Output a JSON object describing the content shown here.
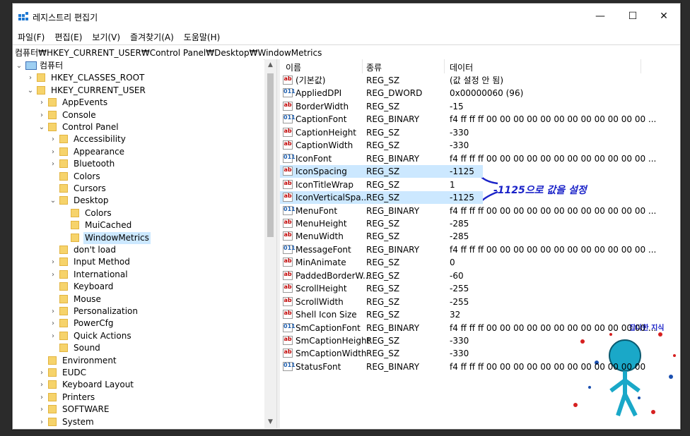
{
  "window": {
    "title": "레지스트리 편집기",
    "controls": {
      "minimize": "—",
      "maximize": "☐",
      "close": "✕"
    }
  },
  "menu": [
    "파일(F)",
    "편집(E)",
    "보기(V)",
    "즐겨찾기(A)",
    "도움말(H)"
  ],
  "address": "컴퓨터₩HKEY_CURRENT_USER₩Control Panel₩Desktop₩WindowMetrics",
  "tree": [
    {
      "label": "컴퓨터",
      "indent": 0,
      "chev": "⌄",
      "type": "pc"
    },
    {
      "label": "HKEY_CLASSES_ROOT",
      "indent": 1,
      "chev": "›"
    },
    {
      "label": "HKEY_CURRENT_USER",
      "indent": 1,
      "chev": "⌄"
    },
    {
      "label": "AppEvents",
      "indent": 2,
      "chev": "›"
    },
    {
      "label": "Console",
      "indent": 2,
      "chev": "›"
    },
    {
      "label": "Control Panel",
      "indent": 2,
      "chev": "⌄"
    },
    {
      "label": "Accessibility",
      "indent": 3,
      "chev": "›"
    },
    {
      "label": "Appearance",
      "indent": 3,
      "chev": "›"
    },
    {
      "label": "Bluetooth",
      "indent": 3,
      "chev": "›"
    },
    {
      "label": "Colors",
      "indent": 3,
      "chev": ""
    },
    {
      "label": "Cursors",
      "indent": 3,
      "chev": ""
    },
    {
      "label": "Desktop",
      "indent": 3,
      "chev": "⌄"
    },
    {
      "label": "Colors",
      "indent": 4,
      "chev": ""
    },
    {
      "label": "MuiCached",
      "indent": 4,
      "chev": ""
    },
    {
      "label": "WindowMetrics",
      "indent": 4,
      "chev": "",
      "selected": true
    },
    {
      "label": "don't load",
      "indent": 3,
      "chev": ""
    },
    {
      "label": "Input Method",
      "indent": 3,
      "chev": "›"
    },
    {
      "label": "International",
      "indent": 3,
      "chev": "›"
    },
    {
      "label": "Keyboard",
      "indent": 3,
      "chev": ""
    },
    {
      "label": "Mouse",
      "indent": 3,
      "chev": ""
    },
    {
      "label": "Personalization",
      "indent": 3,
      "chev": "›"
    },
    {
      "label": "PowerCfg",
      "indent": 3,
      "chev": "›"
    },
    {
      "label": "Quick Actions",
      "indent": 3,
      "chev": "›"
    },
    {
      "label": "Sound",
      "indent": 3,
      "chev": ""
    },
    {
      "label": "Environment",
      "indent": 2,
      "chev": ""
    },
    {
      "label": "EUDC",
      "indent": 2,
      "chev": "›"
    },
    {
      "label": "Keyboard Layout",
      "indent": 2,
      "chev": "›"
    },
    {
      "label": "Printers",
      "indent": 2,
      "chev": "›"
    },
    {
      "label": "SOFTWARE",
      "indent": 2,
      "chev": "›"
    },
    {
      "label": "System",
      "indent": 2,
      "chev": "›"
    }
  ],
  "columns": [
    "이름",
    "종류",
    "데이터"
  ],
  "values": [
    {
      "name": "(기본값)",
      "type": "REG_SZ",
      "data": "(값 설정 안 됨)",
      "icon": "ab"
    },
    {
      "name": "AppliedDPI",
      "type": "REG_DWORD",
      "data": "0x00000060 (96)",
      "icon": "bin"
    },
    {
      "name": "BorderWidth",
      "type": "REG_SZ",
      "data": "-15",
      "icon": "ab"
    },
    {
      "name": "CaptionFont",
      "type": "REG_BINARY",
      "data": "f4 ff ff ff 00 00 00 00 00 00 00 00 00 00 00 00 ...",
      "icon": "bin"
    },
    {
      "name": "CaptionHeight",
      "type": "REG_SZ",
      "data": "-330",
      "icon": "ab"
    },
    {
      "name": "CaptionWidth",
      "type": "REG_SZ",
      "data": "-330",
      "icon": "ab"
    },
    {
      "name": "IconFont",
      "type": "REG_BINARY",
      "data": "f4 ff ff ff 00 00 00 00 00 00 00 00 00 00 00 00 ...",
      "icon": "bin"
    },
    {
      "name": "IconSpacing",
      "type": "REG_SZ",
      "data": "-1125",
      "icon": "ab",
      "highlight": true
    },
    {
      "name": "IconTitleWrap",
      "type": "REG_SZ",
      "data": "1",
      "icon": "ab"
    },
    {
      "name": "IconVerticalSpa...",
      "type": "REG_SZ",
      "data": "-1125",
      "icon": "ab",
      "highlight": true
    },
    {
      "name": "MenuFont",
      "type": "REG_BINARY",
      "data": "f4 ff ff ff 00 00 00 00 00 00 00 00 00 00 00 00 ...",
      "icon": "bin"
    },
    {
      "name": "MenuHeight",
      "type": "REG_SZ",
      "data": "-285",
      "icon": "ab"
    },
    {
      "name": "MenuWidth",
      "type": "REG_SZ",
      "data": "-285",
      "icon": "ab"
    },
    {
      "name": "MessageFont",
      "type": "REG_BINARY",
      "data": "f4 ff ff ff 00 00 00 00 00 00 00 00 00 00 00 00 ...",
      "icon": "bin"
    },
    {
      "name": "MinAnimate",
      "type": "REG_SZ",
      "data": "0",
      "icon": "ab"
    },
    {
      "name": "PaddedBorderW...",
      "type": "REG_SZ",
      "data": "-60",
      "icon": "ab"
    },
    {
      "name": "ScrollHeight",
      "type": "REG_SZ",
      "data": "-255",
      "icon": "ab"
    },
    {
      "name": "ScrollWidth",
      "type": "REG_SZ",
      "data": "-255",
      "icon": "ab"
    },
    {
      "name": "Shell Icon Size",
      "type": "REG_SZ",
      "data": "32",
      "icon": "ab"
    },
    {
      "name": "SmCaptionFont",
      "type": "REG_BINARY",
      "data": "f4 ff ff ff 00 00 00 00 00 00 00 00 00 00 00 00 ...",
      "icon": "bin"
    },
    {
      "name": "SmCaptionHeight",
      "type": "REG_SZ",
      "data": "-330",
      "icon": "ab"
    },
    {
      "name": "SmCaptionWidth",
      "type": "REG_SZ",
      "data": "-330",
      "icon": "ab"
    },
    {
      "name": "StatusFont",
      "type": "REG_BINARY",
      "data": "f4 ff ff ff 00 00 00 00 00 00 00 00 00 00 00 00",
      "icon": "bin"
    }
  ],
  "annotation": "-1125으로 값을 설정",
  "watermark": "잡다한 지식",
  "colors": {
    "selection": "#cce8ff",
    "annotation": "#1a22c8",
    "folder": "#f6d36b"
  }
}
